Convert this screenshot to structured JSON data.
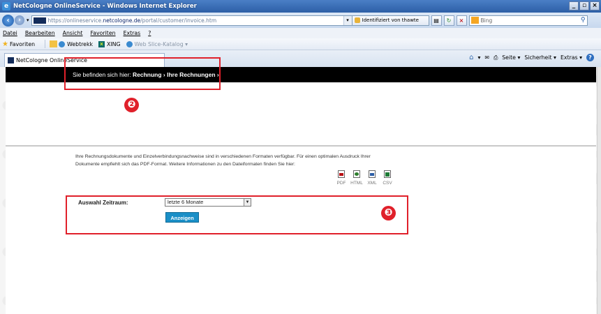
{
  "window": {
    "title": "NetCologne OnlineService - Windows Internet Explorer",
    "controls": [
      "_",
      "2",
      "×"
    ]
  },
  "address": {
    "url_prefix": "https://onlineservice.",
    "url_domain": "netcologne.de",
    "url_path": "/portal/customer/invoice.htm",
    "certificate": "Identifiziert von thawte",
    "search_placeholder": "Bing"
  },
  "menu": [
    "Datei",
    "Bearbeiten",
    "Ansicht",
    "Favoriten",
    "Extras",
    "?"
  ],
  "favorites_bar": {
    "favorites_label": "Favoriten",
    "items": [
      "Webtrekk",
      "XING",
      "Web Slice-Katalog ▾"
    ]
  },
  "tab": {
    "label": "NetCologne OnlineService"
  },
  "command_bar": {
    "page": "Seite ▾",
    "safety": "Sicherheit ▾",
    "tools": "Extras ▾"
  },
  "page": {
    "breadcrumb_prefix": "Sie befinden sich hier:",
    "breadcrumb_path": "Rechnung › Ihre Rechnungen ›",
    "info_line1": "Ihre Rechnungsdokumente und Einzelverbindungsnachweise sind in verschiedenen Formaten verfügbar. Für einen optimalen Ausdruck Ihrer",
    "info_line2": "Dokumente empfiehlt sich das PDF-Format. Weitere Informationen zu den Dateiformaten finden Sie hier:",
    "formats": [
      "PDF",
      "HTML",
      "XML",
      "CSV"
    ],
    "period_label": "Auswahl Zeitraum:",
    "period_value": "letzte 6 Monate",
    "show_button": "Anzeigen"
  },
  "annotations": {
    "marker_2": "❷",
    "marker_3": "❸",
    "color": "#e0202a"
  }
}
